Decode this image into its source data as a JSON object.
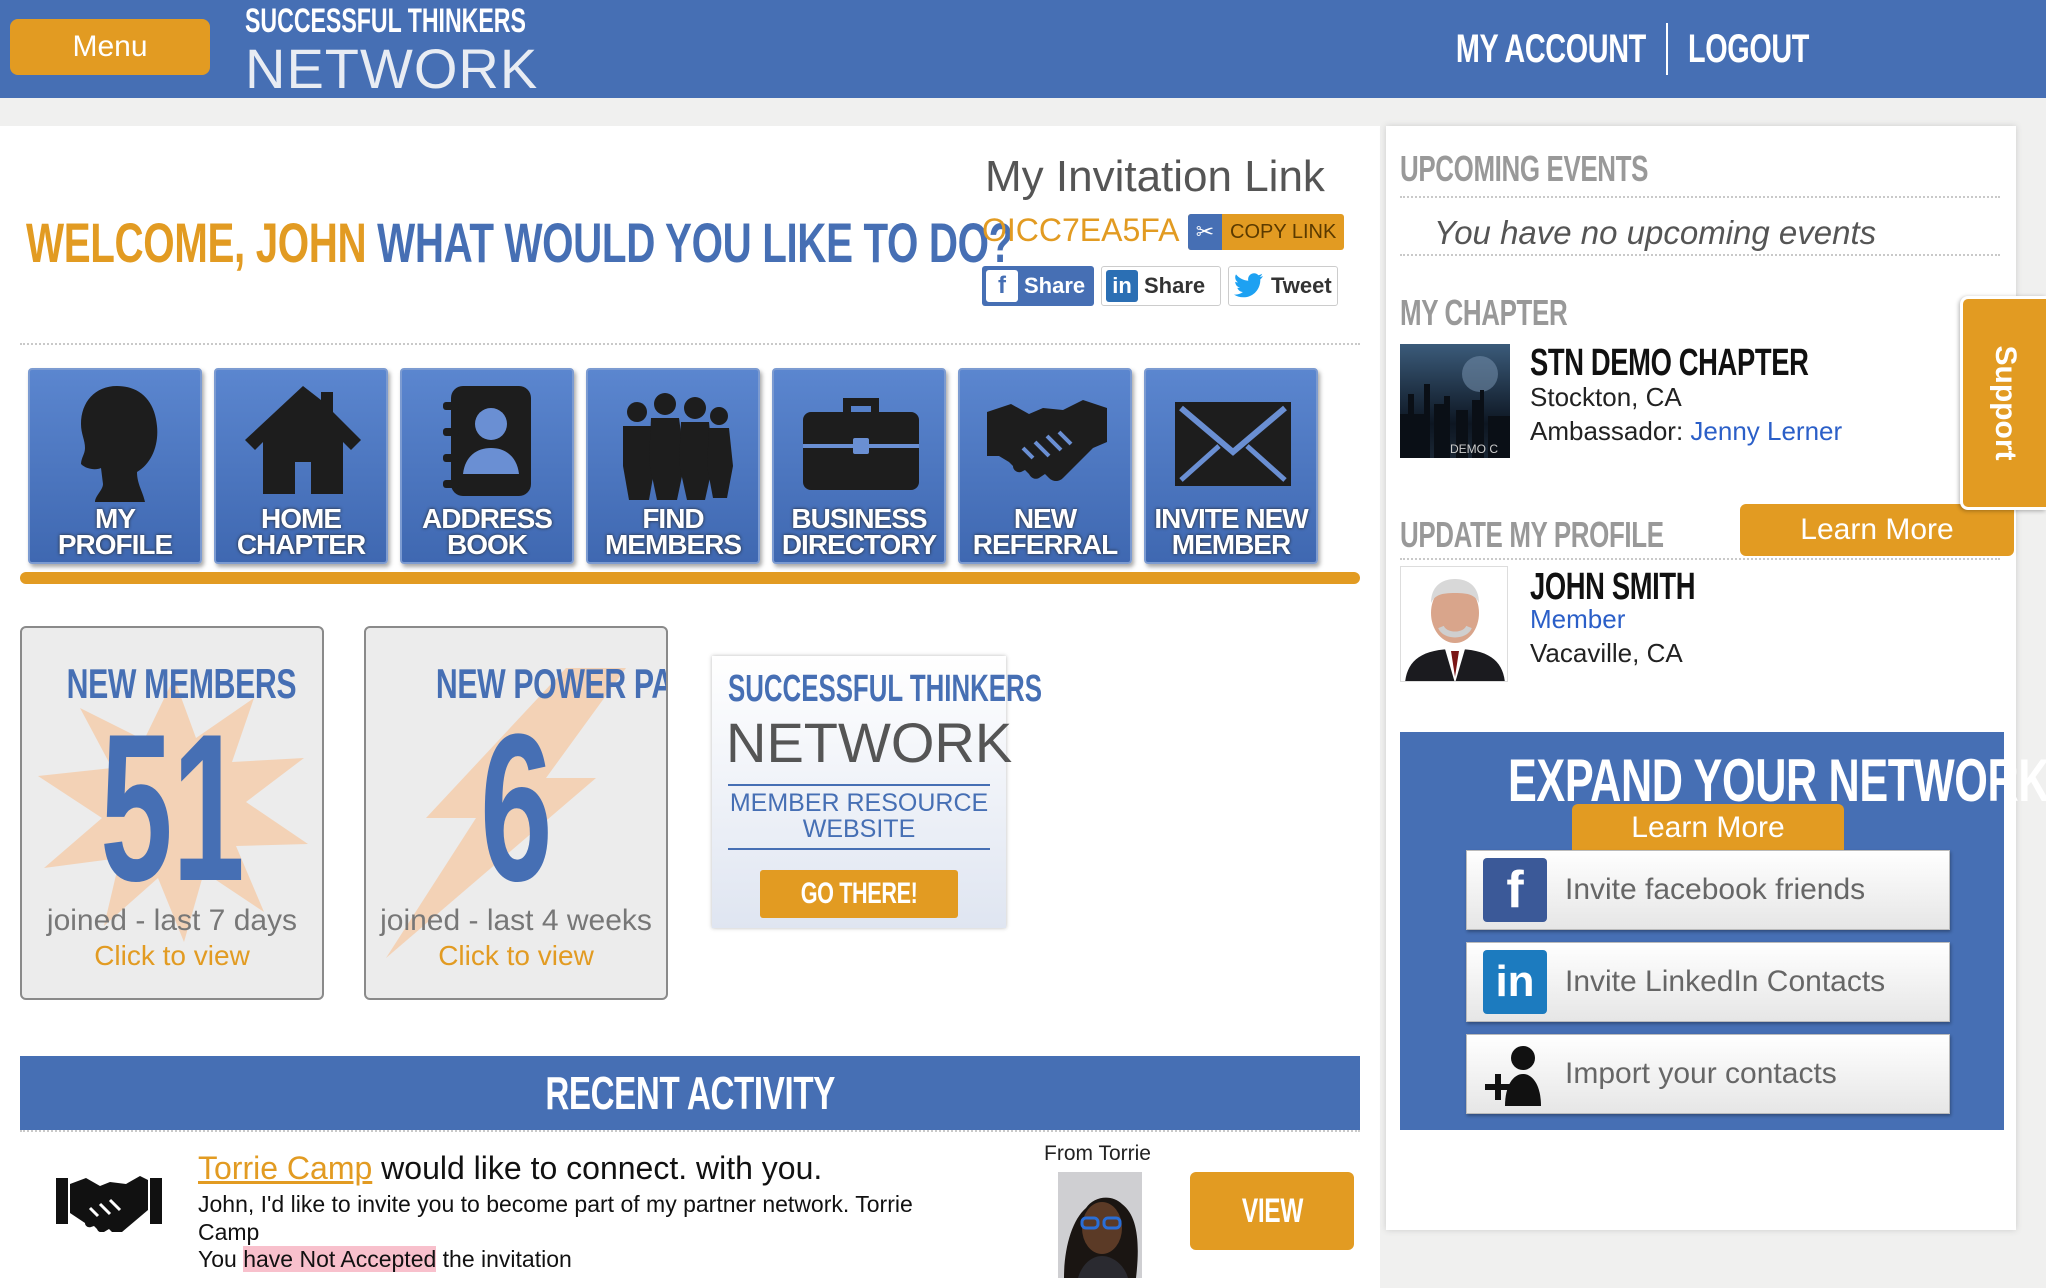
{
  "header": {
    "menu_label": "Menu",
    "logo_line1": "SUCCESSFUL THINKERS",
    "logo_line2": "NETWORK",
    "my_account": "MY ACCOUNT",
    "logout": "LOGOUT"
  },
  "welcome": {
    "greeting": "WELCOME, JOHN",
    "question": "WHAT WOULD YOU LIKE TO DO?"
  },
  "invitation": {
    "title": "My Invitation Link",
    "code": "OICC7EA5FA",
    "copy_label": "COPY LINK",
    "share_facebook": "Share",
    "share_linkedin": "Share",
    "tweet": "Tweet"
  },
  "tiles": [
    {
      "line1": "MY",
      "line2": "PROFILE",
      "icon": "profile-head-icon"
    },
    {
      "line1": "HOME",
      "line2": "CHAPTER",
      "icon": "house-icon"
    },
    {
      "line1": "ADDRESS",
      "line2": "BOOK",
      "icon": "address-book-icon"
    },
    {
      "line1": "FIND",
      "line2": "MEMBERS",
      "icon": "people-group-icon"
    },
    {
      "line1": "BUSINESS",
      "line2": "DIRECTORY",
      "icon": "briefcase-icon"
    },
    {
      "line1": "NEW",
      "line2": "REFERRAL",
      "icon": "handshake-icon"
    },
    {
      "line1": "INVITE NEW",
      "line2": "MEMBER",
      "icon": "envelope-icon"
    }
  ],
  "stats": {
    "new_members": {
      "title": "NEW MEMBERS",
      "number": "51",
      "desc": "joined - last 7 days",
      "link": "Click to view"
    },
    "power_partners": {
      "title": "NEW POWER PARTNERS",
      "number": "6",
      "desc": "joined - last 4 weeks",
      "link": "Click to view"
    }
  },
  "resource": {
    "line1": "SUCCESSFUL THINKERS",
    "line2": "NETWORK",
    "line3": "MEMBER RESOURCE",
    "line4": "WEBSITE",
    "button": "GO THERE!"
  },
  "recent_activity": {
    "title": "RECENT ACTIVITY",
    "items": [
      {
        "name": "Torrie Camp",
        "headline_rest": " would like to connect. with you.",
        "message": "John, I'd like to invite you to become part of my partner network. Torrie Camp",
        "status_prefix": "You ",
        "status_highlight": "have Not Accepted",
        "status_suffix": " the invitation",
        "from": "From Torrie",
        "button": "VIEW"
      }
    ]
  },
  "sidebar": {
    "upcoming_title": "UPCOMING EVENTS",
    "no_events": "You have no upcoming events",
    "chapter_title": "MY CHAPTER",
    "chapter_image_caption": "DEMO C",
    "chapter_name": "STN DEMO CHAPTER",
    "chapter_location": "Stockton, CA",
    "ambassador_label": "Ambassador: ",
    "ambassador_name": "Jenny Lerner",
    "update_title": "UPDATE MY PROFILE",
    "learn_more": "Learn More",
    "profile_name": "JOHN SMITH",
    "profile_role": "Member",
    "profile_location": "Vacaville, CA",
    "expand_title": "EXPAND YOUR NETWORK!",
    "expand_learn_more": "Learn More",
    "invite_facebook": "Invite facebook friends",
    "invite_linkedin": "Invite LinkedIn Contacts",
    "import_contacts": "Import your contacts"
  },
  "support_label": "Support",
  "colors": {
    "brand_blue": "#466fb4",
    "accent_orange": "#e29b22"
  }
}
